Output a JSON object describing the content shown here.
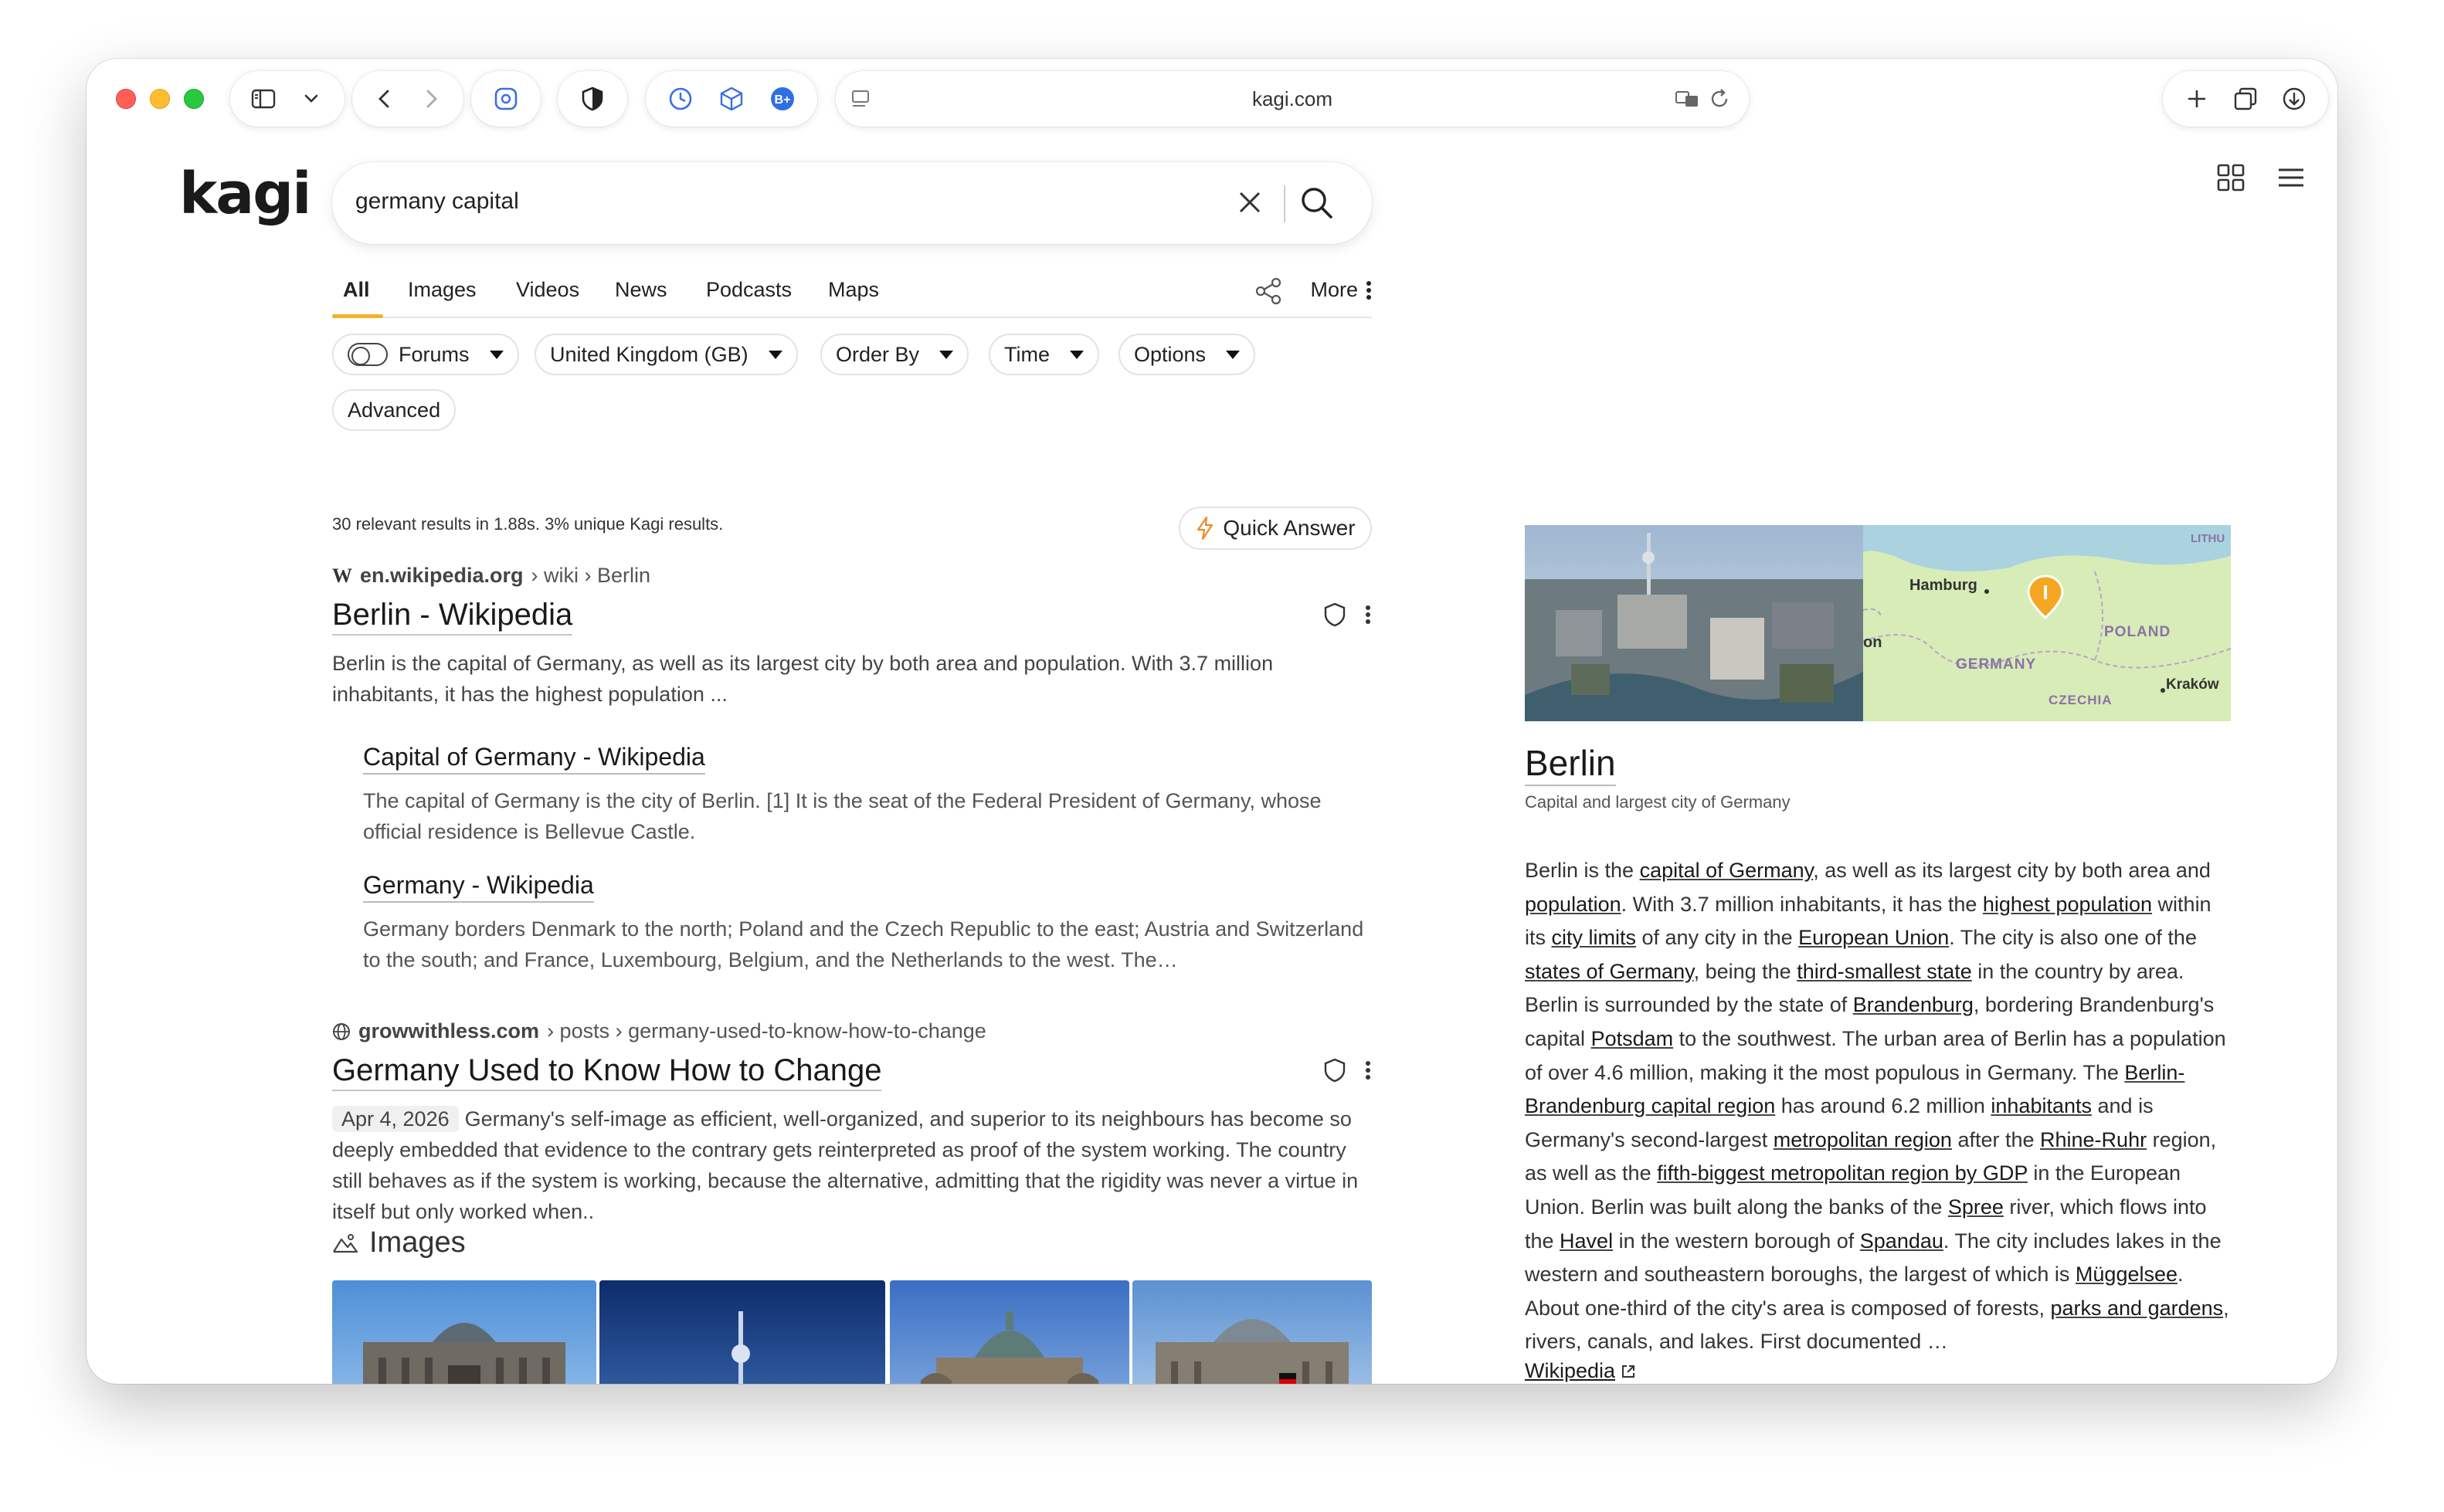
{
  "browser": {
    "url": "kagi.com"
  },
  "search": {
    "logo": "kagi",
    "query": "germany capital"
  },
  "tabs": [
    {
      "label": "All",
      "active": true
    },
    {
      "label": "Images"
    },
    {
      "label": "Videos"
    },
    {
      "label": "News"
    },
    {
      "label": "Podcasts"
    },
    {
      "label": "Maps"
    }
  ],
  "more_label": "More",
  "filters": {
    "forums": "Forums",
    "region": "United Kingdom (GB)",
    "order_by": "Order By",
    "time": "Time",
    "options": "Options",
    "advanced": "Advanced"
  },
  "stats": "30 relevant results in 1.88s. 3% unique Kagi results.",
  "quick_answer": "Quick Answer",
  "results": [
    {
      "domain": "en.wikipedia.org",
      "path": "› wiki › Berlin",
      "title": "Berlin - Wikipedia",
      "snippet": "Berlin is the capital of Germany, as well as its largest city by both area and population. With 3.7 million inhabitants, it has the highest population ...",
      "subresults": [
        {
          "title": "Capital of Germany - Wikipedia",
          "snippet": "The capital of Germany is the city of Berlin. [1] It is the seat of the Federal President of Germany, whose official residence is Bellevue Castle."
        },
        {
          "title": "Germany - Wikipedia",
          "snippet": "Germany borders Denmark to the north; Poland and the Czech Republic to the east; Austria and Switzerland to the south; and France, Luxembourg, Belgium, and the Netherlands to the west. The…"
        }
      ]
    },
    {
      "domain": "growwithless.com",
      "path": "› posts › germany-used-to-know-how-to-change",
      "title": "Germany Used to Know How to Change",
      "date": "Apr 4, 2026",
      "snippet": "Germany's self-image as efficient, well-organized, and superior to its neighbours has become so deeply embedded that evidence to the contrary gets reinterpreted as proof of the system working. The country still behaves as if the system is working, because the alternative, admitting that the rigidity was never a virtue in itself but only worked when.."
    }
  ],
  "images_heading": "Images",
  "knowledge_panel": {
    "title": "Berlin",
    "subtitle": "Capital and largest city of Germany",
    "map_labels": {
      "hamburg": "Hamburg",
      "germany": "GERMANY",
      "poland": "POLAND",
      "czechia": "CZECHIA",
      "krakow": "Kraków",
      "lithuania": "LITHU",
      "edge": "on"
    },
    "description": [
      {
        "t": "Berlin is the "
      },
      {
        "t": "capital of Germany",
        "l": true
      },
      {
        "t": ", as well as its largest city by both area and "
      },
      {
        "t": "population",
        "l": true
      },
      {
        "t": ". With 3.7 million inhabitants, it has the "
      },
      {
        "t": "highest population",
        "l": true
      },
      {
        "t": " within its "
      },
      {
        "t": "city limits",
        "l": true
      },
      {
        "t": " of any city in the "
      },
      {
        "t": "European Union",
        "l": true
      },
      {
        "t": ". The city is also one of the "
      },
      {
        "t": "states of Germany",
        "l": true
      },
      {
        "t": ", being the "
      },
      {
        "t": "third-smallest state",
        "l": true
      },
      {
        "t": " in the country by area. Berlin is surrounded by the state of "
      },
      {
        "t": "Brandenburg",
        "l": true
      },
      {
        "t": ", bordering Brandenburg's capital "
      },
      {
        "t": "Potsdam",
        "l": true
      },
      {
        "t": " to the southwest. The urban area of Berlin has a population of over 4.6 million, making it the most populous in Germany. The "
      },
      {
        "t": "Berlin-Brandenburg capital region",
        "l": true
      },
      {
        "t": " has around 6.2 million "
      },
      {
        "t": "inhabitants",
        "l": true
      },
      {
        "t": " and is Germany's second-largest "
      },
      {
        "t": "metropolitan region",
        "l": true
      },
      {
        "t": " after the "
      },
      {
        "t": "Rhine-Ruhr",
        "l": true
      },
      {
        "t": " region, as well as the "
      },
      {
        "t": "fifth-biggest metropolitan region by GDP",
        "l": true
      },
      {
        "t": " in the European Union. Berlin was built along the banks of the "
      },
      {
        "t": "Spree",
        "l": true
      },
      {
        "t": " river, which flows into the "
      },
      {
        "t": "Havel",
        "l": true
      },
      {
        "t": " in the western borough of "
      },
      {
        "t": "Spandau",
        "l": true
      },
      {
        "t": ". The city includes lakes in the western and southeastern boroughs, the largest of which is "
      },
      {
        "t": "Müggelsee",
        "l": true
      },
      {
        "t": ". About one-third of the city's area is composed of forests, "
      },
      {
        "t": "parks and gardens",
        "l": true
      },
      {
        "t": ", rivers, canals, and lakes. First documented …"
      }
    ],
    "source": "Wikipedia"
  },
  "colors": {
    "accent": "#f0b429",
    "map_land": "#d8ecb7",
    "map_pin": "#f5a623"
  }
}
